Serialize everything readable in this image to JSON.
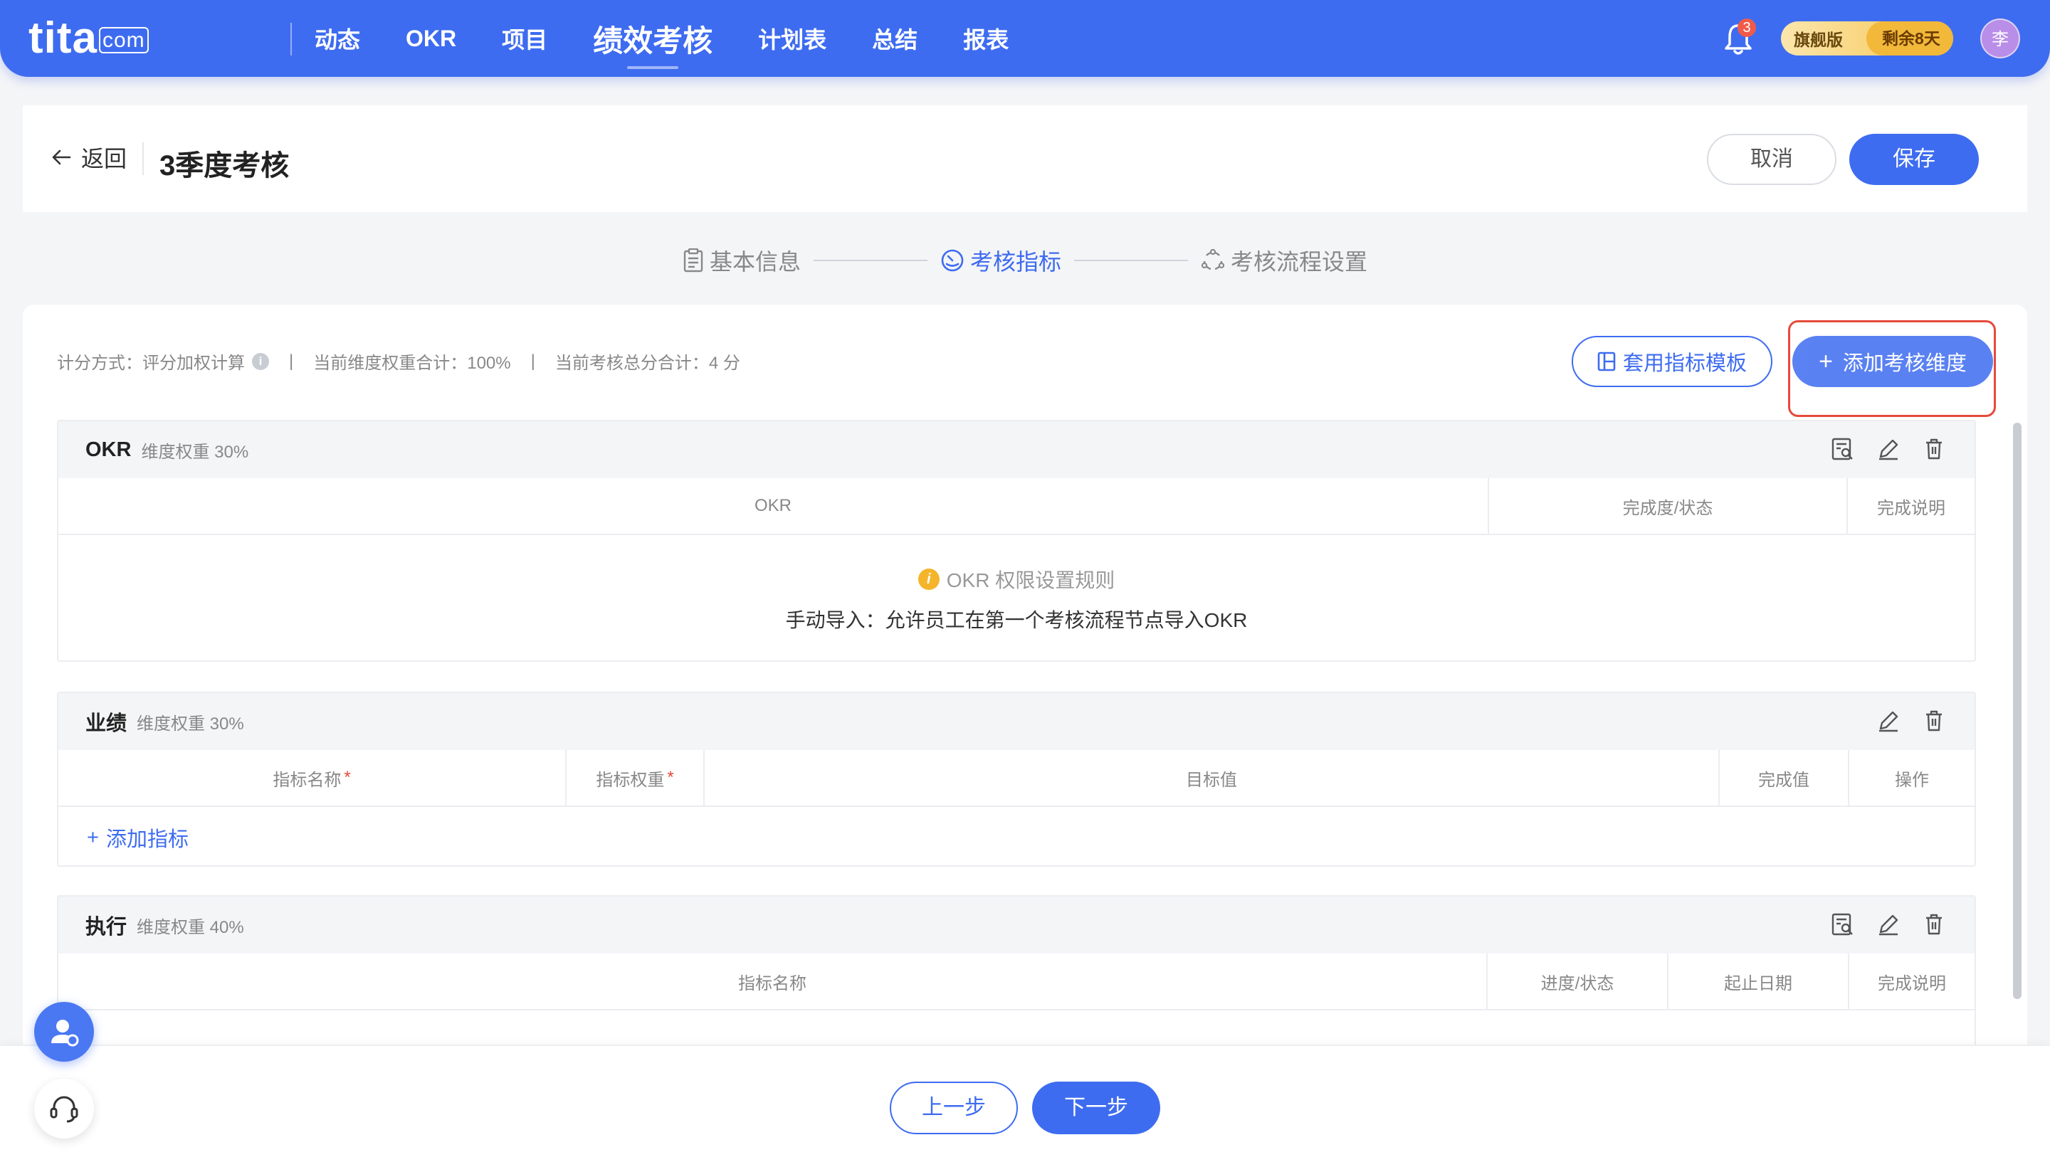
{
  "nav": {
    "logo": "tita",
    "logo_suffix": "com",
    "items": [
      "动态",
      "OKR",
      "项目",
      "绩效考核",
      "计划表",
      "总结",
      "报表"
    ],
    "notifications": "3",
    "edition": "旗舰版",
    "trial_remaining": "剩余8天",
    "avatar": "李"
  },
  "header": {
    "back": "返回",
    "title": "3季度考核",
    "cancel": "取消",
    "save": "保存"
  },
  "steps": [
    "基本信息",
    "考核指标",
    "考核流程设置"
  ],
  "summary": {
    "scoring": "计分方式：评分加权计算",
    "sep": "|",
    "weight_total": "当前维度权重合计：100%",
    "score_total": "当前考核总分合计：4 分"
  },
  "actions": {
    "apply_template": "套用指标模板",
    "add_dimension": "添加考核维度"
  },
  "dimensions": {
    "okr": {
      "name": "OKR",
      "weight": "维度权重 30%",
      "columns": [
        "OKR",
        "完成度/状态",
        "完成说明"
      ],
      "rule_title": "OKR 权限设置规则",
      "rule_desc": "手动导入：允许员工在第一个考核流程节点导入OKR"
    },
    "performance": {
      "name": "业绩",
      "weight": "维度权重 30%",
      "columns": [
        "指标名称",
        "指标权重",
        "目标值",
        "完成值",
        "操作"
      ],
      "required_mark": "*",
      "add_metric": "添加指标"
    },
    "execution": {
      "name": "执行",
      "weight": "维度权重 40%",
      "columns": [
        "指标名称",
        "进度/状态",
        "起止日期",
        "完成说明"
      ]
    }
  },
  "footer": {
    "prev": "上一步",
    "next": "下一步"
  },
  "colors": {
    "primary": "#3e6cf0",
    "highlight": "#e64a3b",
    "badge": "#f05a4a"
  }
}
